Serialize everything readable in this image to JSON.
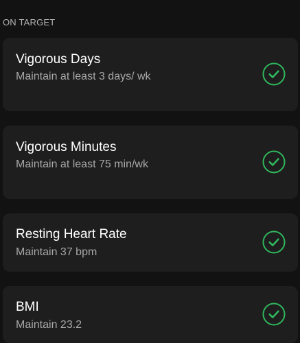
{
  "section": {
    "header": "ON TARGET"
  },
  "cards": [
    {
      "title": "Vigorous Days",
      "description": "Maintain at least 3 days/ wk",
      "status_icon": "check-circle-icon"
    },
    {
      "title": "Vigorous Minutes",
      "description": "Maintain at least 75 min/wk",
      "status_icon": "check-circle-icon"
    },
    {
      "title": "Resting Heart Rate",
      "description": "Maintain 37 bpm",
      "status_icon": "check-circle-icon"
    },
    {
      "title": "BMI",
      "description": "Maintain 23.2",
      "status_icon": "check-circle-icon"
    }
  ],
  "colors": {
    "background": "#121212",
    "card": "#1e1e1e",
    "accent_green": "#2fb85c",
    "header_text": "#b5b5b5",
    "secondary_text": "#a8a8a8"
  }
}
